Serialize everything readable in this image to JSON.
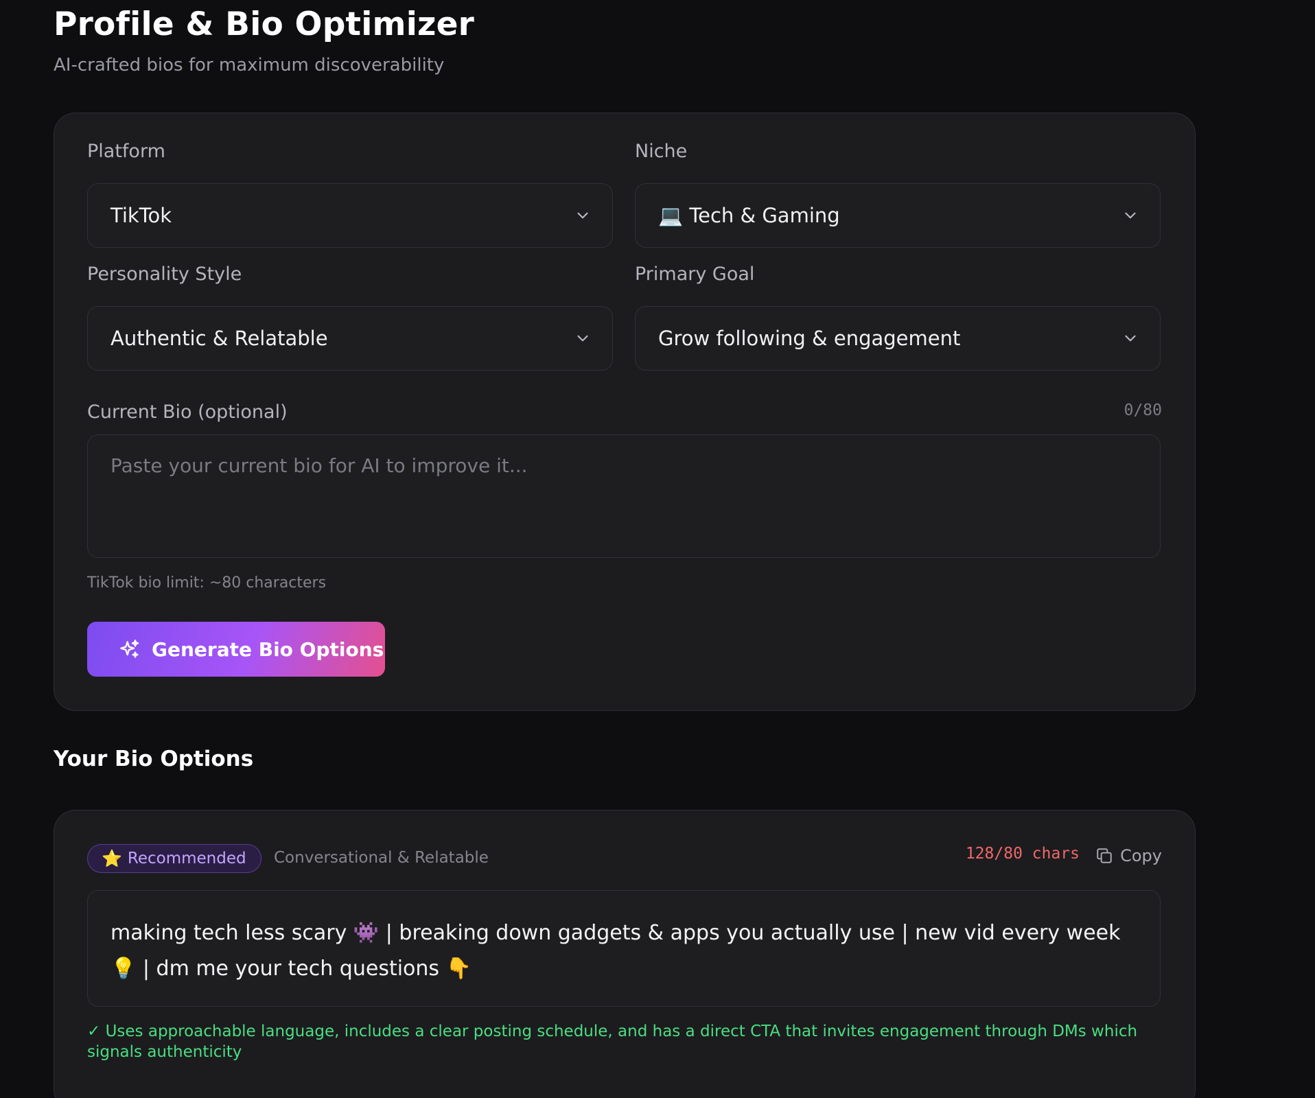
{
  "header": {
    "title": "Profile & Bio Optimizer",
    "subtitle": "AI-crafted bios for maximum discoverability"
  },
  "form": {
    "platform": {
      "label": "Platform",
      "value": "TikTok"
    },
    "niche": {
      "label": "Niche",
      "value": "💻 Tech & Gaming"
    },
    "personality": {
      "label": "Personality Style",
      "value": "Authentic & Relatable"
    },
    "goal": {
      "label": "Primary Goal",
      "value": "Grow following & engagement"
    },
    "current_bio": {
      "label": "Current Bio (optional)",
      "placeholder": "Paste your current bio for AI to improve it...",
      "value": "",
      "count": "0/80"
    },
    "hint": "TikTok bio limit: ~80 characters",
    "generate_label": "Generate Bio Options"
  },
  "results": {
    "section_title": "Your Bio Options",
    "options": [
      {
        "badge": "Recommended",
        "badge_icon": "⭐",
        "style": "Conversational & Relatable",
        "chars": "128/80 chars",
        "copy_label": "Copy",
        "bio": "making tech less scary 👾 | breaking down gadgets & apps you actually use | new vid every week 💡 | dm me your tech questions 👇",
        "rationale": "✓ Uses approachable language, includes a clear posting schedule, and has a direct CTA that invites engagement through DMs which signals authenticity"
      }
    ]
  },
  "colors": {
    "background": "#0e0e11",
    "card": "#1c1c1f",
    "accent_gradient_start": "#7c4cf0",
    "accent_gradient_end": "#e4508f",
    "over_limit": "#f06868",
    "success": "#4ade80"
  },
  "icons": {
    "dropdown": "chevron-down-icon",
    "generate": "sparkles-icon",
    "copy": "copy-icon",
    "badge": "star-icon"
  }
}
